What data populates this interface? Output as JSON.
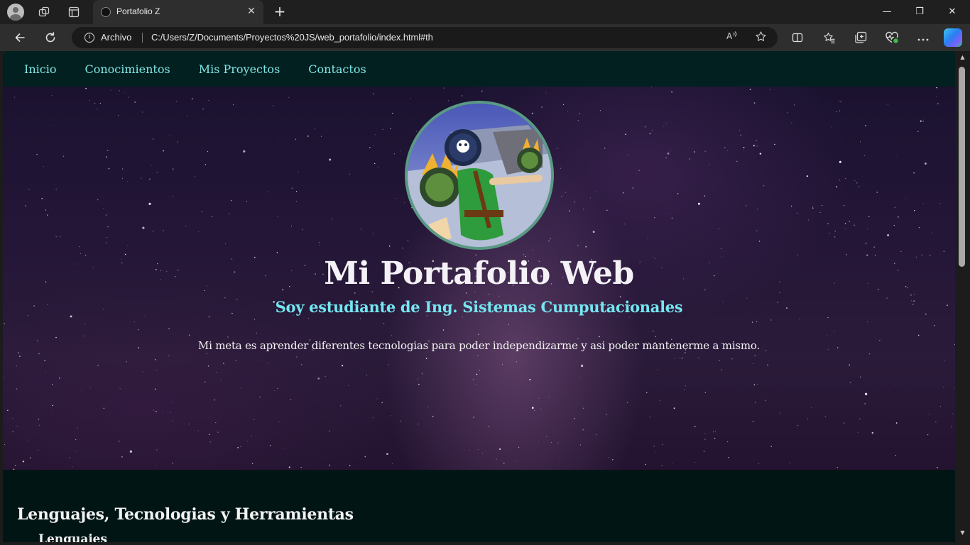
{
  "browser": {
    "tab_title": "Portafolio Z",
    "tab_close": "✕",
    "new_tab": "+",
    "omnibox_label": "Archivo",
    "url": "C:/Users/Z/Documents/Proyectos%20JS/web_portafolio/index.html#th",
    "icons": [
      "profile-avatar",
      "workspaces-icon",
      "tab-actions-icon",
      "back-icon",
      "refresh-icon",
      "info-icon",
      "read-aloud-icon",
      "favorite-star-icon",
      "split-screen-icon",
      "favorites-icon",
      "collections-icon",
      "performance-icon",
      "more-icon",
      "copilot-icon"
    ]
  },
  "window": {
    "minimize": "—",
    "restore": "❐",
    "close": "✕"
  },
  "nav": {
    "items": [
      "Inicio",
      "Conocimientos",
      "Mis Proyectos",
      "Contactos"
    ]
  },
  "hero": {
    "title": "Mi Portafolio Web",
    "subtitle": "Soy estudiante de Ing. Sistemas Cumputacionales",
    "text": "Mi meta es aprender diferentes tecnologias para poder independizarme y asi poder mantenerme a mismo."
  },
  "skills": {
    "title": "Lenguajes, Tecnologias y Herramientas",
    "subtitle": "Lenguajes"
  },
  "colors": {
    "nav_bg": "#022020",
    "nav_link": "#7fe7e7",
    "subtitle": "#74e6f0",
    "page_bg": "#021515"
  }
}
